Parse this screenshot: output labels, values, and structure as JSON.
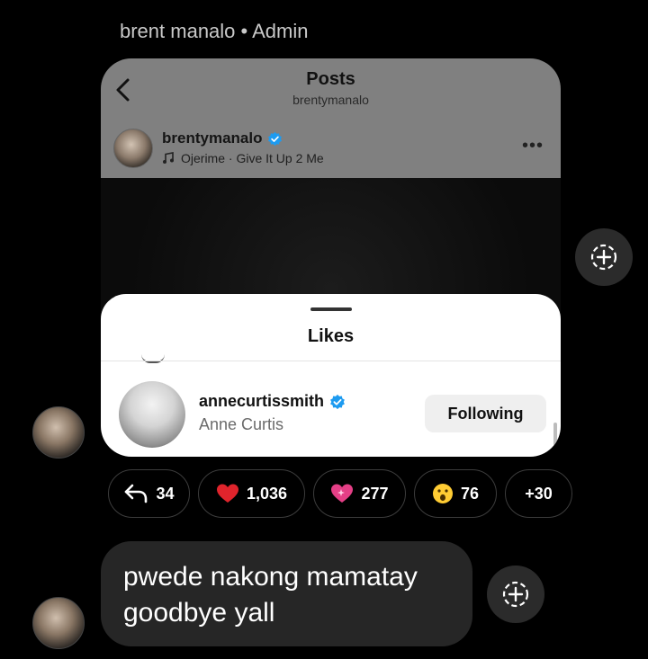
{
  "header": {
    "sender": "brent manalo • Admin"
  },
  "post": {
    "title": "Posts",
    "subtitle": "brentymanalo",
    "username": "brentymanalo",
    "song": "Ojerime · Give It Up 2 Me",
    "more_icon": "more-dots-icon"
  },
  "likes_sheet": {
    "title": "Likes",
    "user": {
      "username": "annecurtissmith",
      "display_name": "Anne Curtis",
      "button": "Following"
    }
  },
  "reactions": [
    {
      "icon": "reply-arrow-icon",
      "count": "34"
    },
    {
      "icon": "red-heart-icon",
      "count": "1,036"
    },
    {
      "icon": "sparkling-heart-icon",
      "count": "277"
    },
    {
      "icon": "surprised-face-icon",
      "count": "76"
    },
    {
      "icon": "",
      "count": "+30"
    }
  ],
  "message": {
    "text": "pwede nakong mamatay goodbye yall"
  },
  "colors": {
    "verified": "#1d9bf0",
    "heart": "#e0242c",
    "sparkle_heart": "#e43f86",
    "bubble": "#262626"
  }
}
